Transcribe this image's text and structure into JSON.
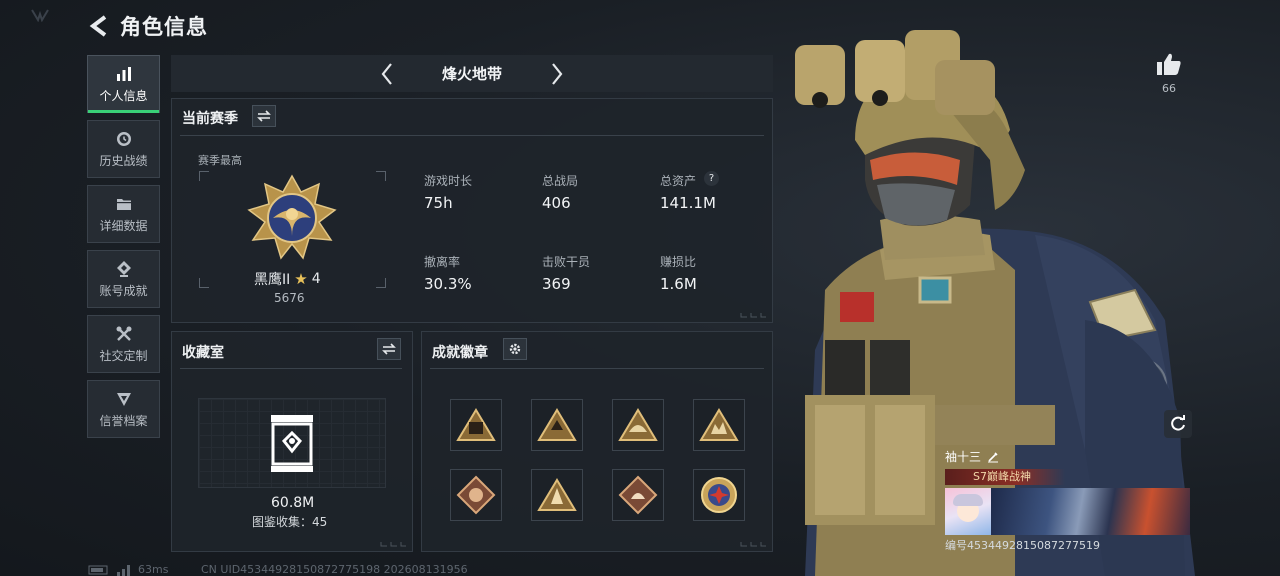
{
  "header": {
    "title": "角色信息"
  },
  "sidebar": {
    "items": [
      {
        "label": "个人信息",
        "icon": "bar-chart-icon",
        "active": true
      },
      {
        "label": "历史战绩",
        "icon": "history-clock-icon"
      },
      {
        "label": "详细数据",
        "icon": "folder-icon"
      },
      {
        "label": "账号成就",
        "icon": "achievement-icon"
      },
      {
        "label": "社交定制",
        "icon": "tools-icon"
      },
      {
        "label": "信誉档案",
        "icon": "credibility-icon"
      }
    ]
  },
  "map_selector": {
    "name": "烽火地带"
  },
  "season": {
    "title": "当前赛季",
    "best_label": "赛季最高",
    "rank_name": "黑鹰II",
    "rank_stars": "4",
    "rank_score": "5676",
    "stats": [
      {
        "label": "游戏时长",
        "value": "75h"
      },
      {
        "label": "总战局",
        "value": "406"
      },
      {
        "label": "总资产",
        "value": "141.1M"
      },
      {
        "label": "撤离率",
        "value": "30.3%"
      },
      {
        "label": "击败干员",
        "value": "369"
      },
      {
        "label": "赚损比",
        "value": "1.6M"
      }
    ]
  },
  "collection": {
    "title": "收藏室",
    "value": "60.8M",
    "progress_label": "图鉴收集：45"
  },
  "achievements": {
    "title": "成就徽章",
    "badge_count": 8
  },
  "like": {
    "count": "66"
  },
  "player_card": {
    "name": "袖十三",
    "title_badge": "S7巅峰战神",
    "id_label": "编号4534492815087277519"
  },
  "footer": {
    "ping": "63ms",
    "uid_text": "CN UID45344928150872775198 202608131956"
  },
  "colors": {
    "accent_green": "#39d077",
    "gold": "#c9a45a",
    "background": "#171c22"
  }
}
